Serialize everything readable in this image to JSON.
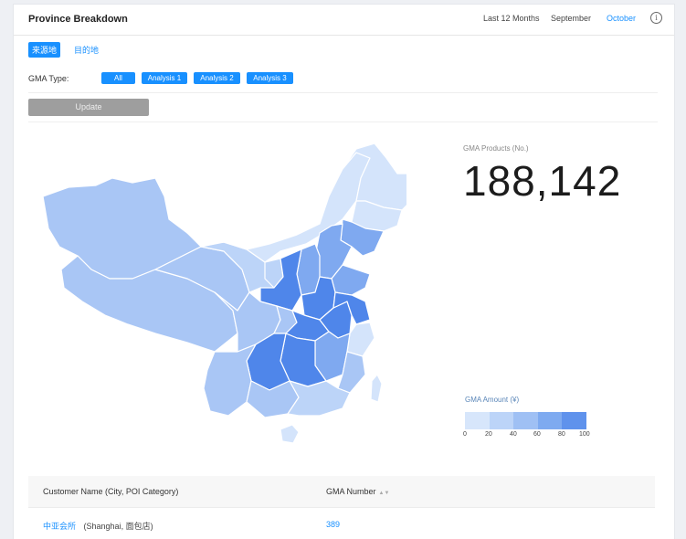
{
  "header": {
    "title": "Province Breakdown",
    "periods": [
      "Last 12 Months",
      "September",
      "October"
    ],
    "active_period": "October",
    "info_icon": "info-circle-icon"
  },
  "source_tabs": [
    {
      "label": "来源地",
      "active": true
    },
    {
      "label": "目的地",
      "active": false
    }
  ],
  "filter": {
    "label": "GMA Type:",
    "options": [
      "All",
      "Analysis 1",
      "Analysis 2",
      "Analysis 3"
    ]
  },
  "update_label": "Update",
  "kpi": {
    "label": "GMA Products (No.)",
    "value": "188,142"
  },
  "legend": {
    "title": "GMA Amount (¥)",
    "ticks": [
      "0",
      "20",
      "40",
      "60",
      "80",
      "100"
    ],
    "colors": [
      "#d7e6fb",
      "#bcd4f8",
      "#9fc0f4",
      "#7eaaf0",
      "#5f92ec"
    ]
  },
  "table": {
    "columns": [
      "Customer Name (City, POI Category)",
      "GMA Number"
    ],
    "sort_icon": "sort-icon",
    "rows": [
      {
        "name": "中亚会所",
        "detail": "(Shanghai, 面包店)",
        "number": "389"
      }
    ]
  },
  "colors": {
    "accent": "#1890ff",
    "map_light": "#d4e4fb",
    "map_mid": "#a9c6f5",
    "map_strong": "#7fa9f0",
    "map_dark": "#4f86ea"
  }
}
